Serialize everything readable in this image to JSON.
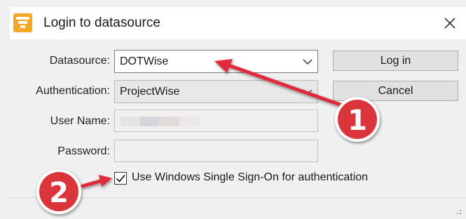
{
  "window": {
    "title": "Login to datasource",
    "app_icon": "datasource-icon",
    "close_icon": "close-icon"
  },
  "form": {
    "datasource": {
      "label": "Datasource:",
      "value": "DOTWise"
    },
    "authentication": {
      "label": "Authentication:",
      "value": "ProjectWise"
    },
    "username": {
      "label": "User Name:",
      "value": ""
    },
    "password": {
      "label": "Password:",
      "value": ""
    },
    "sso": {
      "label": "Use Windows Single Sign-On for authentication",
      "checked": true
    }
  },
  "buttons": {
    "login": "Log in",
    "cancel": "Cancel"
  },
  "annotations": {
    "badge_1": "1",
    "badge_2": "2",
    "arrow_color": "#e02a3a",
    "badge_color": "#d9343a"
  },
  "colors": {
    "titlebar_bg": "#ffffff",
    "dialog_bg": "#f0f0f0",
    "icon_orange": "#f5a623"
  }
}
